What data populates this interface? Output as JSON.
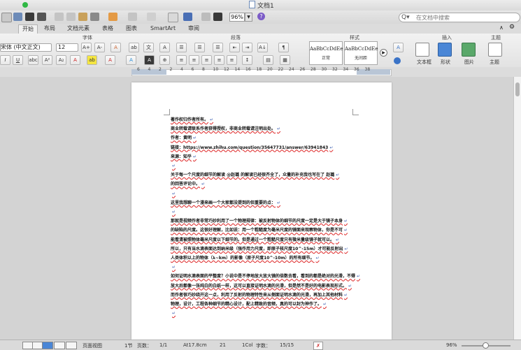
{
  "window": {
    "title": "文档1"
  },
  "toolbar": {
    "zoom": "96%",
    "search_placeholder": "在文档中搜索"
  },
  "ribbon_tabs": [
    "开始",
    "布局",
    "文档元素",
    "表格",
    "图表",
    "SmartArt",
    "审阅"
  ],
  "ribbon": {
    "groups": {
      "font": "字体",
      "paragraph": "段落",
      "styles": "样式",
      "insert": "插入",
      "theme": "主题"
    },
    "font_name": "宋体 (中文正文)",
    "font_size": "12",
    "styles": [
      {
        "sample": "AaBbCcDdEe",
        "label": "正常"
      },
      {
        "sample": "AaBbCcDdEe",
        "label": "无间距"
      }
    ],
    "insert_items": [
      "文本框",
      "形状",
      "图片"
    ],
    "theme_items": [
      "主题"
    ]
  },
  "ruler": {
    "numbers": [
      "6",
      "4",
      "2",
      "2",
      "4",
      "6",
      "8",
      "10",
      "12",
      "14",
      "16",
      "18",
      "20",
      "22",
      "24",
      "26",
      "28",
      "30",
      "32",
      "34",
      "36",
      "38"
    ]
  },
  "document": {
    "lines": [
      {
        "text": "著作权归作者所有。",
        "plain": false
      },
      {
        "text": "商业转载请联系作者获得授权，非商业转载请注明出处。",
        "plain": false
      },
      {
        "text": "作者：黄明",
        "plain": false
      },
      {
        "text": "链接：https://www.zhihu.com/question/35647731/answer/63941843",
        "plain": false
      },
      {
        "text": "来源：知乎",
        "plain": false
      },
      {
        "text": "",
        "plain": true
      },
      {
        "text": "关于每一个尺度的细节的解读 @赵璐 的解读已经很齐全了，众量的补充我也写在了 赵璐",
        "plain": false
      },
      {
        "text": "的回答评论中。",
        "plain": false
      },
      {
        "text": "",
        "plain": true
      },
      {
        "text": "这里我想聊一个漫来画一个大家都没提到的但重要的点：",
        "plain": false
      },
      {
        "text": "",
        "plain": true
      },
      {
        "text": "那就是视频作者非常巧妙利用了一个物理规律：被反射物体的细节的尺度一定是大于镜子本身",
        "plain": false
      },
      {
        "text": "的缺陷的尺度。这很好理解，比如说：用一个粗糙度为毫米尺度的镜面来观察物体，你是不可",
        "plain": false
      },
      {
        "text": "能看清被照物体毫米尺度以下细节的。但是通过一个粗糙尺度只有微米量级镜子就可以。",
        "plain": false
      },
      {
        "text": "所以，只有当水滴表面达到纳米级（强作用力尺度，即原子核尺度10^-15m）才可能反射出",
        "plain": false
      },
      {
        "text": "人类体积以上的物体（λ~km）的影像（原子尺度10^-10m）的所有细节。",
        "plain": false
      },
      {
        "text": "",
        "plain": true
      },
      {
        "text": "如何证明水滴表面的平整度？小说中是不停地放大放大镜的倍数去看，看到的都是绝对的光滑，不得",
        "plain": false
      },
      {
        "text": "放大后都像一张纯白的白纸一样，这可以直接证明水滴的光滑，但是然不是好的电影表现形式。",
        "plain": false
      },
      {
        "text": "而作者很巧妙绕开这一点，利用了反射的物理特性来从侧面证明水滴的光滑，再加上其他材料",
        "plain": false
      },
      {
        "text": "物理，设计，工程各种细节的精心设计，配上精致的音频，真的可以封为神作了。",
        "plain": false
      },
      {
        "text": "",
        "plain": true
      }
    ]
  },
  "statusbar": {
    "view_label": "页面视图",
    "section": "1节",
    "pages_label": "页数：",
    "pages": "1/1",
    "at": "At17.8cm",
    "line": "21",
    "col": "1Col",
    "words_label": "字数：",
    "words": "15/15",
    "zoom": "96%"
  }
}
